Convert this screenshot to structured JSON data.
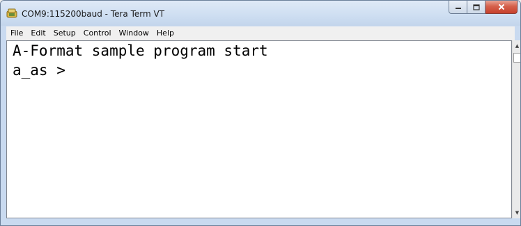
{
  "window": {
    "title": "COM9:115200baud - Tera Term VT",
    "app_icon": "tera-term-icon",
    "frame_color": "#c9daf0",
    "close_color": "#c7402c"
  },
  "menubar": {
    "items": [
      "File",
      "Edit",
      "Setup",
      "Control",
      "Window",
      "Help"
    ]
  },
  "terminal": {
    "lines": [
      "A-Format sample program start",
      "a_as >"
    ],
    "background": "#ffffff",
    "foreground": "#000000"
  },
  "scrollbar": {
    "up_icon": "scroll-up-arrow-icon",
    "down_icon": "scroll-down-arrow-icon"
  }
}
